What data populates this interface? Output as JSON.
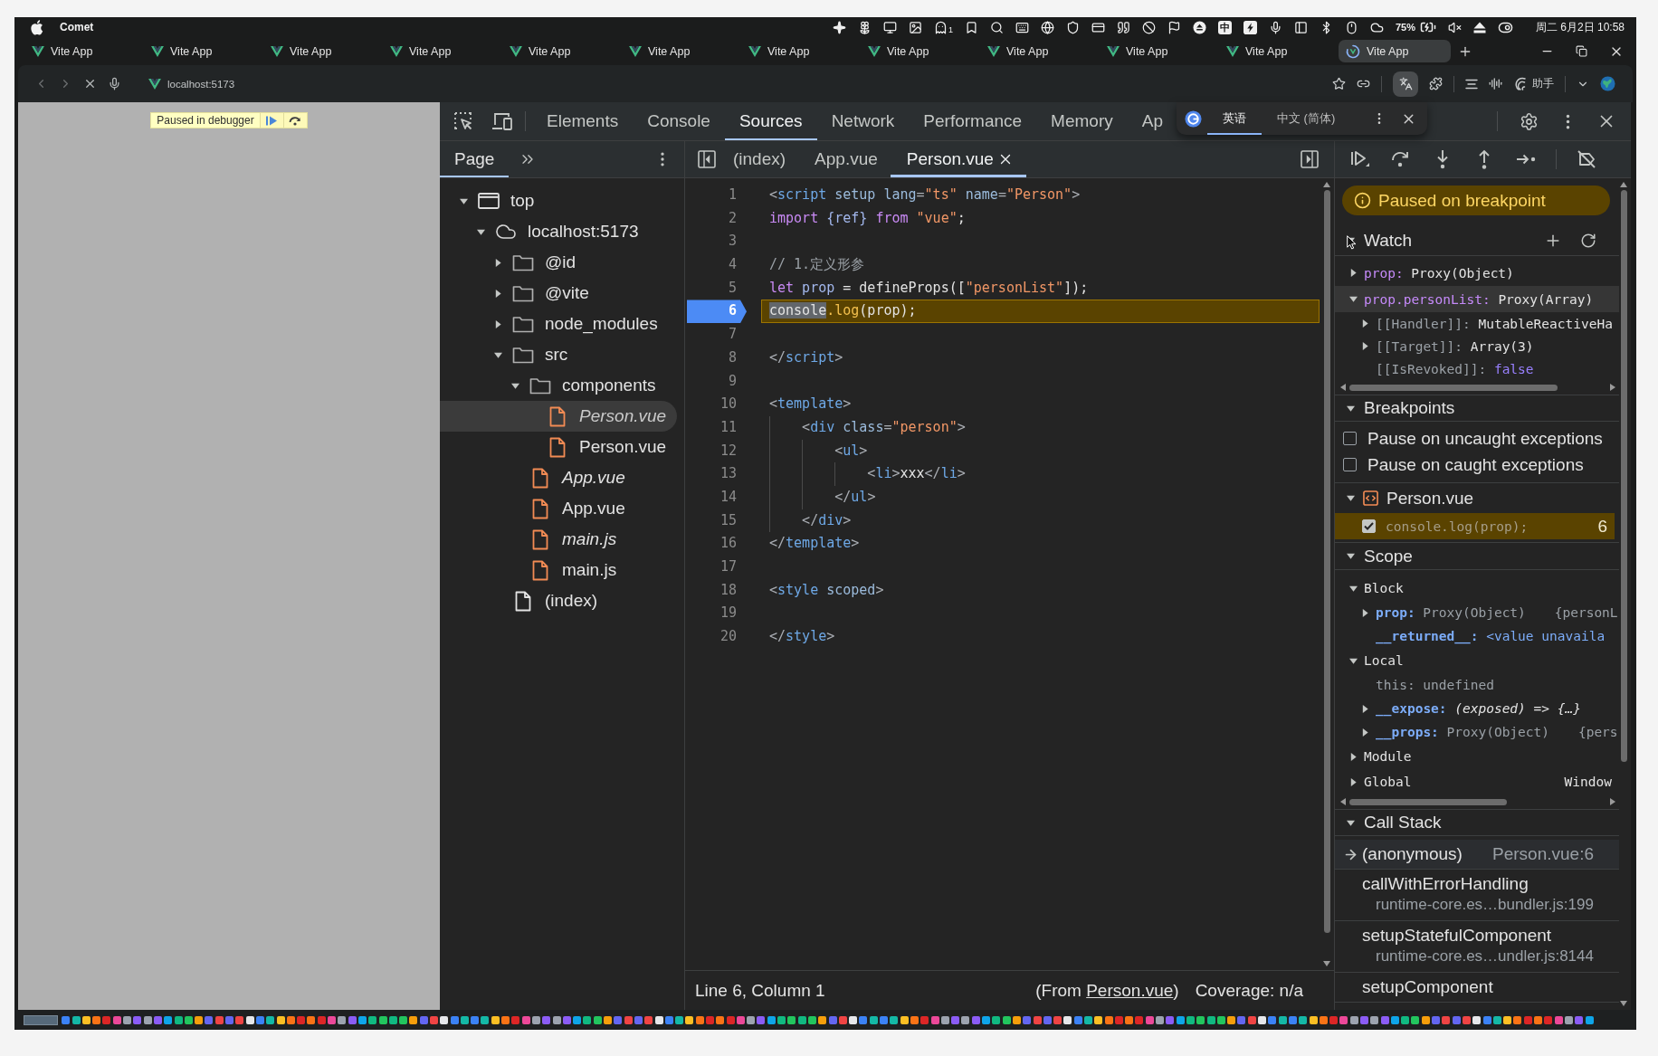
{
  "menu_bar": {
    "app_name": "Comet",
    "status_badge": "1",
    "input_method": "中",
    "battery": "75%",
    "clock": "周二 6月2日 10:58"
  },
  "browser_tabs": [
    {
      "title": "Vite App",
      "selected": false,
      "loading": false
    },
    {
      "title": "Vite App",
      "selected": false,
      "loading": false
    },
    {
      "title": "Vite App",
      "selected": false,
      "loading": false
    },
    {
      "title": "Vite App",
      "selected": false,
      "loading": false
    },
    {
      "title": "Vite App",
      "selected": false,
      "loading": false
    },
    {
      "title": "Vite App",
      "selected": false,
      "loading": false
    },
    {
      "title": "Vite App",
      "selected": false,
      "loading": false
    },
    {
      "title": "Vite App",
      "selected": false,
      "loading": false
    },
    {
      "title": "Vite App",
      "selected": false,
      "loading": false
    },
    {
      "title": "Vite App",
      "selected": false,
      "loading": false
    },
    {
      "title": "Vite App",
      "selected": false,
      "loading": false
    },
    {
      "title": "Vite App",
      "selected": true,
      "loading": true
    }
  ],
  "address_bar": {
    "url": "localhost:5173",
    "translate_open": true,
    "assistant": "助手"
  },
  "page": {
    "paused_badge": "Paused in debugger"
  },
  "translate_popup": {
    "languages": [
      {
        "label": "英语",
        "selected": true
      },
      {
        "label": "中文 (简体)",
        "selected": false
      }
    ]
  },
  "devtools": {
    "tabs": [
      {
        "label": "Elements",
        "selected": false
      },
      {
        "label": "Console",
        "selected": false
      },
      {
        "label": "Sources",
        "selected": true
      },
      {
        "label": "Network",
        "selected": false
      },
      {
        "label": "Performance",
        "selected": false
      },
      {
        "label": "Memory",
        "selected": false
      },
      {
        "label": "Ap",
        "selected": false
      }
    ],
    "navigator": {
      "tabs": [
        {
          "label": "Page",
          "selected": true
        }
      ],
      "tree": [
        {
          "label": "top",
          "kind": "frame",
          "expanded": true,
          "selected": false,
          "children": [
            {
              "label": "localhost:5173",
              "kind": "origin",
              "expanded": true,
              "selected": false,
              "children": [
                {
                  "label": "@id",
                  "kind": "folder",
                  "expanded": false,
                  "selected": false
                },
                {
                  "label": "@vite",
                  "kind": "folder",
                  "expanded": false,
                  "selected": false
                },
                {
                  "label": "node_modules",
                  "kind": "folder",
                  "expanded": false,
                  "selected": false
                },
                {
                  "label": "src",
                  "kind": "folder",
                  "expanded": true,
                  "selected": false,
                  "children": [
                    {
                      "label": "components",
                      "kind": "folder",
                      "expanded": true,
                      "selected": false,
                      "children": [
                        {
                          "label": "Person.vue",
                          "kind": "file",
                          "italic": true,
                          "selected": true
                        },
                        {
                          "label": "Person.vue",
                          "kind": "file",
                          "italic": false,
                          "selected": false
                        }
                      ]
                    },
                    {
                      "label": "App.vue",
                      "kind": "file",
                      "italic": true,
                      "selected": false
                    },
                    {
                      "label": "App.vue",
                      "kind": "file",
                      "italic": false,
                      "selected": false
                    },
                    {
                      "label": "main.js",
                      "kind": "file",
                      "italic": true,
                      "selected": false
                    },
                    {
                      "label": "main.js",
                      "kind": "file",
                      "italic": false,
                      "selected": false
                    }
                  ]
                },
                {
                  "label": "(index)",
                  "kind": "document",
                  "italic": false,
                  "selected": false
                }
              ]
            }
          ]
        }
      ]
    },
    "editor": {
      "tabs": [
        {
          "label": "(index)",
          "selected": false
        },
        {
          "label": "App.vue",
          "selected": false
        },
        {
          "label": "Person.vue",
          "selected": true
        }
      ],
      "lines": [
        {
          "number": "1",
          "breakpoint": false,
          "paused": false,
          "tokens": [
            {
              "kind": "punct",
              "text": "<"
            },
            {
              "kind": "tag",
              "text": "script"
            },
            {
              "kind": "attr",
              "text": " setup lang"
            },
            {
              "kind": "punct",
              "text": "="
            },
            {
              "kind": "value",
              "text": "\"ts\""
            },
            {
              "kind": "attr",
              "text": " name"
            },
            {
              "kind": "punct",
              "text": "="
            },
            {
              "kind": "value",
              "text": "\"Person\""
            },
            {
              "kind": "punct",
              "text": ">"
            }
          ]
        },
        {
          "number": "2",
          "breakpoint": false,
          "paused": false,
          "tokens": [
            {
              "kind": "keyword",
              "text": "import"
            },
            {
              "kind": "variable",
              "text": " {ref} "
            },
            {
              "kind": "keyword",
              "text": "from"
            },
            {
              "kind": "value",
              "text": " \"vue\""
            },
            {
              "kind": "plain",
              "text": ";"
            }
          ]
        },
        {
          "number": "3",
          "breakpoint": false,
          "paused": false
        },
        {
          "number": "4",
          "breakpoint": false,
          "paused": false,
          "tokens": [
            {
              "kind": "comment",
              "text": "// 1.定义形参"
            }
          ]
        },
        {
          "number": "5",
          "breakpoint": false,
          "paused": false,
          "tokens": [
            {
              "kind": "keyword",
              "text": "let"
            },
            {
              "kind": "variable",
              "text": " prop"
            },
            {
              "kind": "plain",
              "text": " = defineProps(["
            },
            {
              "kind": "value",
              "text": "\"personList\""
            },
            {
              "kind": "plain",
              "text": "]);"
            }
          ]
        },
        {
          "number": "6",
          "breakpoint": true,
          "paused": true,
          "tokens": [
            {
              "kind": "match",
              "text": "console"
            },
            {
              "kind": "method",
              "text": ".log"
            },
            {
              "kind": "plain",
              "text": "(prop);"
            }
          ]
        },
        {
          "number": "7",
          "breakpoint": false,
          "paused": false
        },
        {
          "number": "8",
          "breakpoint": false,
          "paused": false,
          "tokens": [
            {
              "kind": "punct",
              "text": "</"
            },
            {
              "kind": "tag",
              "text": "script"
            },
            {
              "kind": "punct",
              "text": ">"
            }
          ]
        },
        {
          "number": "9",
          "breakpoint": false,
          "paused": false
        },
        {
          "number": "10",
          "breakpoint": false,
          "paused": false,
          "tokens": [
            {
              "kind": "punct",
              "text": "<"
            },
            {
              "kind": "tag",
              "text": "template"
            },
            {
              "kind": "punct",
              "text": ">"
            }
          ]
        },
        {
          "number": "11",
          "breakpoint": false,
          "paused": false,
          "tokens": [
            {
              "kind": "punct",
              "text": "    <"
            },
            {
              "kind": "tag",
              "text": "div"
            },
            {
              "kind": "attr",
              "text": " class"
            },
            {
              "kind": "punct",
              "text": "="
            },
            {
              "kind": "value",
              "text": "\"person\""
            },
            {
              "kind": "punct",
              "text": ">"
            }
          ]
        },
        {
          "number": "12",
          "breakpoint": false,
          "paused": false,
          "tokens": [
            {
              "kind": "punct",
              "text": "        <"
            },
            {
              "kind": "tag",
              "text": "ul"
            },
            {
              "kind": "punct",
              "text": ">"
            }
          ]
        },
        {
          "number": "13",
          "breakpoint": false,
          "paused": false,
          "tokens": [
            {
              "kind": "punct",
              "text": "            <"
            },
            {
              "kind": "tag",
              "text": "li"
            },
            {
              "kind": "punct",
              "text": ">"
            },
            {
              "kind": "plain",
              "text": "xxx"
            },
            {
              "kind": "punct",
              "text": "</"
            },
            {
              "kind": "tag",
              "text": "li"
            },
            {
              "kind": "punct",
              "text": ">"
            }
          ]
        },
        {
          "number": "14",
          "breakpoint": false,
          "paused": false,
          "tokens": [
            {
              "kind": "punct",
              "text": "        </"
            },
            {
              "kind": "tag",
              "text": "ul"
            },
            {
              "kind": "punct",
              "text": ">"
            }
          ]
        },
        {
          "number": "15",
          "breakpoint": false,
          "paused": false,
          "tokens": [
            {
              "kind": "punct",
              "text": "    </"
            },
            {
              "kind": "tag",
              "text": "div"
            },
            {
              "kind": "punct",
              "text": ">"
            }
          ]
        },
        {
          "number": "16",
          "breakpoint": false,
          "paused": false,
          "tokens": [
            {
              "kind": "punct",
              "text": "</"
            },
            {
              "kind": "tag",
              "text": "template"
            },
            {
              "kind": "punct",
              "text": ">"
            }
          ]
        },
        {
          "number": "17",
          "breakpoint": false,
          "paused": false
        },
        {
          "number": "18",
          "breakpoint": false,
          "paused": false,
          "tokens": [
            {
              "kind": "punct",
              "text": "<"
            },
            {
              "kind": "tag",
              "text": "style"
            },
            {
              "kind": "attr",
              "text": " scoped"
            },
            {
              "kind": "punct",
              "text": ">"
            }
          ]
        },
        {
          "number": "19",
          "breakpoint": false,
          "paused": false
        },
        {
          "number": "20",
          "breakpoint": false,
          "paused": false,
          "tokens": [
            {
              "kind": "punct",
              "text": "</"
            },
            {
              "kind": "tag",
              "text": "style"
            },
            {
              "kind": "punct",
              "text": ">"
            }
          ]
        }
      ],
      "status": {
        "position": "Line 6, Column 1",
        "source_prefix": "(From ",
        "source_link": "Person.vue",
        "source_suffix": ")",
        "coverage": "Coverage: n/a"
      }
    },
    "sidebar": {
      "paused_message": "Paused on breakpoint",
      "watch": {
        "title": "Watch",
        "expanded": true,
        "items": [
          {
            "name": "prop:",
            "kind": "expression",
            "value": "Proxy(Object)",
            "expanded": false,
            "selected": false
          },
          {
            "name": "prop.personList:",
            "kind": "expression",
            "value": "Proxy(Array)",
            "expanded": true,
            "selected": true,
            "children": [
              {
                "name": "[[Handler]]:",
                "kind": "internal",
                "value": "MutableReactiveHa",
                "expanded": false,
                "selected": false
              },
              {
                "name": "[[Target]]:",
                "kind": "internal",
                "value": "Array(3)",
                "expanded": false,
                "selected": false
              },
              {
                "name": "[[IsRevoked]]:",
                "kind": "boolean",
                "value": "false",
                "selected": false
              }
            ]
          }
        ]
      },
      "breakpoints": {
        "title": "Breakpoints",
        "expanded": true,
        "options": [
          {
            "label": "Pause on uncaught exceptions",
            "checked": false
          },
          {
            "label": "Pause on caught exceptions",
            "checked": false
          }
        ],
        "files": [
          {
            "name": "Person.vue",
            "expanded": true,
            "items": [
              {
                "code": "console.log(prop);",
                "line": "6",
                "checked": true,
                "hit": true
              }
            ]
          }
        ]
      },
      "scope": {
        "title": "Scope",
        "expanded": true,
        "groups": [
          {
            "label": "Block",
            "expanded": true,
            "children": [
              {
                "name": "prop:",
                "kind": "property",
                "value": "Proxy(Object)",
                "preview": "{personL",
                "expanded": false,
                "selected": false
              },
              {
                "name": "__returned__:",
                "kind": "unavailable",
                "value": "<value unavaila",
                "selected": false
              }
            ]
          },
          {
            "label": "Local",
            "expanded": true,
            "children": [
              {
                "name": "this:",
                "kind": "undefined",
                "value": "undefined",
                "selected": false
              },
              {
                "name": "__expose:",
                "kind": "function",
                "value": "(exposed) => {…}",
                "expanded": false,
                "selected": false
              },
              {
                "name": "__props:",
                "kind": "property",
                "value": "Proxy(Object)",
                "preview": "{pers",
                "expanded": false,
                "selected": false
              }
            ]
          },
          {
            "label": "Module",
            "expanded": false
          },
          {
            "label": "Global",
            "expanded": false,
            "value": "Window"
          }
        ]
      },
      "call_stack": {
        "title": "Call Stack",
        "expanded": true,
        "frames": [
          {
            "function": "(anonymous)",
            "location": "Person.vue:6",
            "selected": true
          },
          {
            "function": "callWithErrorHandling",
            "location": "runtime-core.es…bundler.js:199",
            "selected": false
          },
          {
            "function": "setupStatefulComponent",
            "location": "runtime-core.es…undler.js:8144",
            "selected": false
          },
          {
            "function": "setupComponent",
            "selected": false
          }
        ]
      }
    }
  }
}
